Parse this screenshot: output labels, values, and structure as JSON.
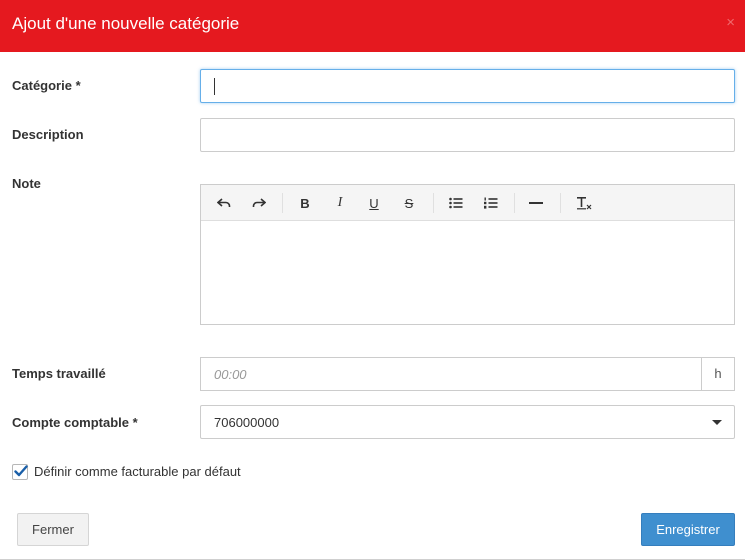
{
  "dialog": {
    "title": "Ajout d'une nouvelle catégorie",
    "close_glyph": "×",
    "header_color": "#e5191f"
  },
  "form": {
    "category": {
      "label": "Catégorie *",
      "value": ""
    },
    "description": {
      "label": "Description",
      "value": ""
    },
    "note": {
      "label": "Note",
      "toolbar": [
        "undo-icon",
        "redo-icon",
        "bold-icon",
        "italic-icon",
        "underline-icon",
        "strikethrough-icon",
        "bulleted-list-icon",
        "numbered-list-icon",
        "horizontal-rule-icon",
        "clear-formatting-icon"
      ],
      "content": ""
    },
    "time_worked": {
      "label": "Temps travaillé",
      "placeholder": "00:00",
      "unit": "h"
    },
    "account": {
      "label": "Compte comptable *",
      "selected": "706000000"
    },
    "billable_default": {
      "label": "Définir comme facturable par défaut",
      "checked": true
    }
  },
  "footer": {
    "close_label": "Fermer",
    "save_label": "Enregistrer",
    "save_color": "#3f8fcf"
  }
}
